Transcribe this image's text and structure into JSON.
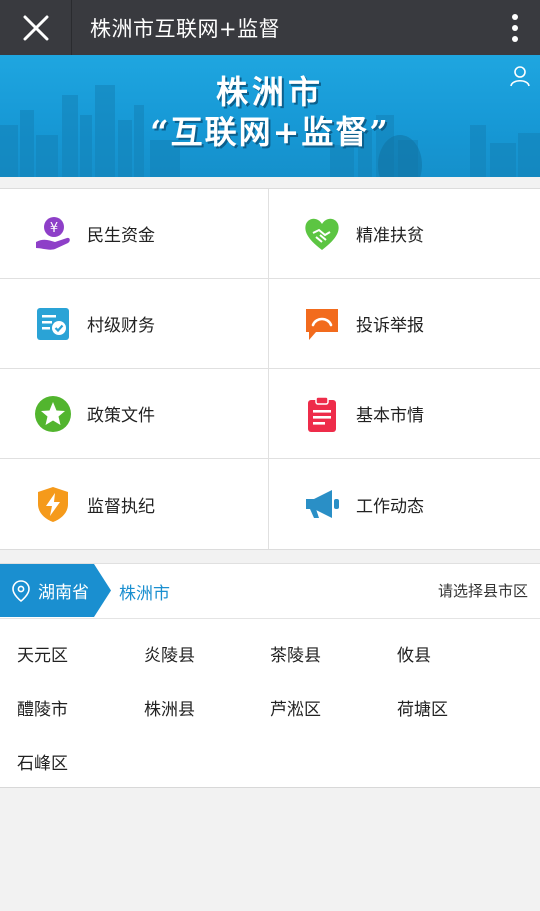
{
  "header": {
    "title": "株洲市互联网+监督"
  },
  "banner": {
    "line1": "株洲市",
    "line2": "“互联网+监督”"
  },
  "menu": [
    {
      "label": "民生资金",
      "icon": "money-hand-icon",
      "color": "#8e3fc8"
    },
    {
      "label": "精准扶贫",
      "icon": "heart-handshake-icon",
      "color": "#5cc542"
    },
    {
      "label": "村级财务",
      "icon": "document-check-icon",
      "color": "#2aa3d6"
    },
    {
      "label": "投诉举报",
      "icon": "complaint-bubble-icon",
      "color": "#f26b1d"
    },
    {
      "label": "政策文件",
      "icon": "star-icon",
      "color": "#52b52e"
    },
    {
      "label": "基本市情",
      "icon": "clipboard-icon",
      "color": "#ee2c4a"
    },
    {
      "label": "监督执纪",
      "icon": "lightning-shield-icon",
      "color": "#f59a1b"
    },
    {
      "label": "工作动态",
      "icon": "megaphone-icon",
      "color": "#2a8fc6"
    }
  ],
  "region": {
    "province": "湖南省",
    "city": "株洲市",
    "select_prompt": "请选择县市区",
    "counties": [
      "天元区",
      "炎陵县",
      "茶陵县",
      "攸县",
      "醴陵市",
      "株洲县",
      "芦淞区",
      "荷塘区",
      "石峰区"
    ]
  },
  "colors": {
    "accent": "#1a8fd0",
    "topbar": "#393a3f"
  }
}
